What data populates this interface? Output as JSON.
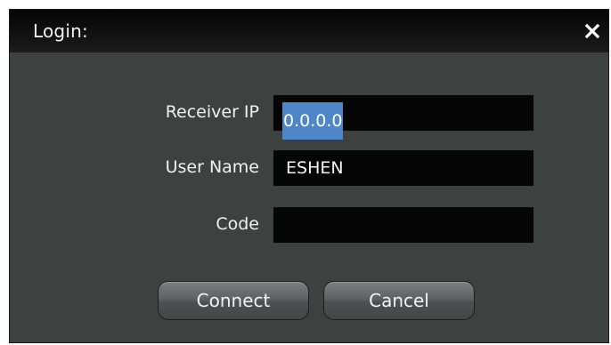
{
  "dialog": {
    "title": "Login:",
    "close_icon": "close-icon"
  },
  "form": {
    "receiver_ip": {
      "label": "Receiver IP",
      "value": "0.0.0.0"
    },
    "user_name": {
      "label": "User Name",
      "value": "ESHEN"
    },
    "code": {
      "label": "Code",
      "value": ""
    }
  },
  "buttons": {
    "connect": "Connect",
    "cancel": "Cancel"
  },
  "colors": {
    "dialog_background": "#3d4140",
    "titlebar": "#0a0a0a",
    "input_background": "#050505",
    "selection": "#4f86c8"
  }
}
